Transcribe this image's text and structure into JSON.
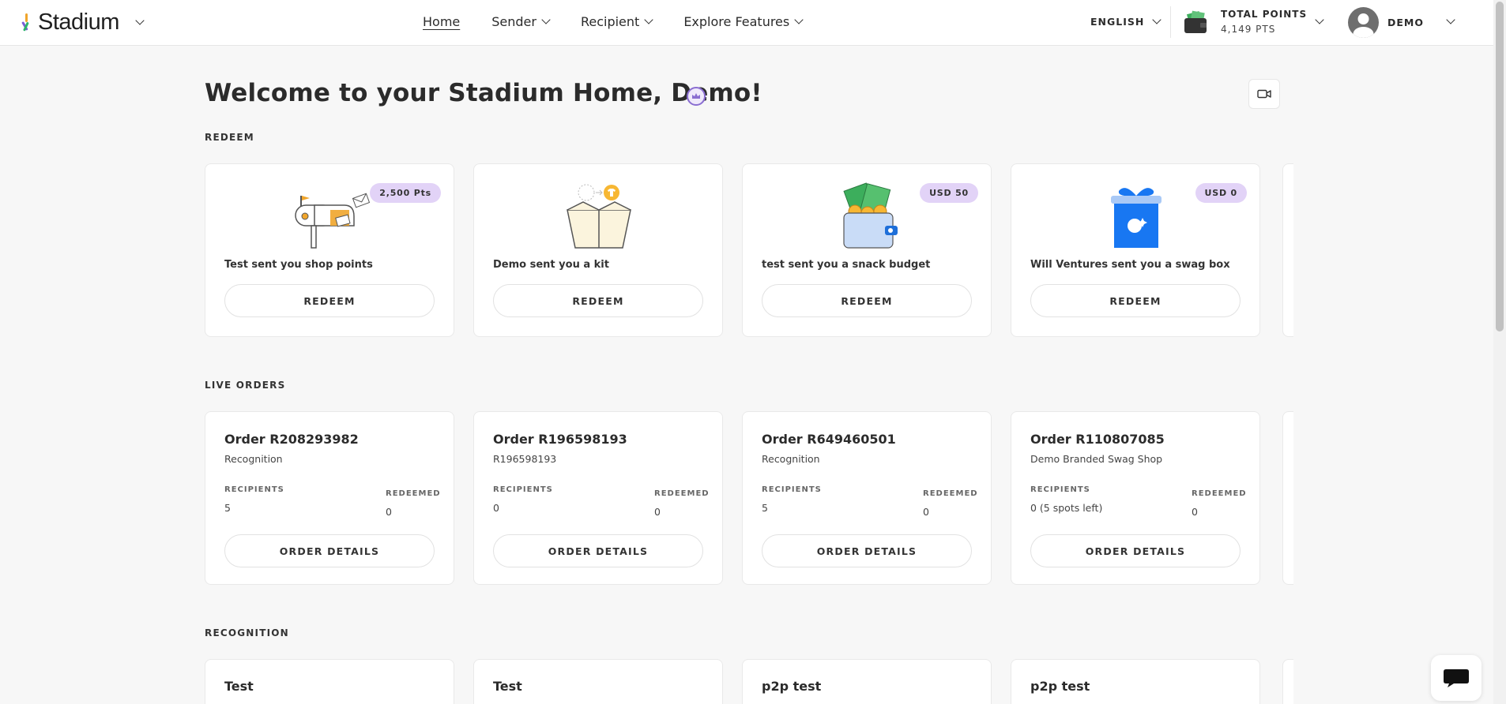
{
  "header": {
    "logo_text": "Stadium",
    "nav": [
      {
        "label": "Home",
        "active": true
      },
      {
        "label": "Sender"
      },
      {
        "label": "Recipient"
      },
      {
        "label": "Explore Features"
      }
    ],
    "language": "ENGLISH",
    "points_label": "TOTAL POINTS",
    "points_value": "4,149 PTS",
    "user_name": "DEMO"
  },
  "welcome": "Welcome to your Stadium Home, Demo!",
  "sections": {
    "redeem": "REDEEM",
    "live_orders": "LIVE ORDERS",
    "recognition": "RECOGNITION"
  },
  "redeem_cards": [
    {
      "text": "Test sent you shop points",
      "badge": "2,500 Pts",
      "button": "REDEEM",
      "icon": "mailbox-icon"
    },
    {
      "text": "Demo sent you a kit",
      "badge": "",
      "button": "REDEEM",
      "icon": "box-icon"
    },
    {
      "text": "test sent you a snack budget",
      "badge": "USD 50",
      "button": "REDEEM",
      "icon": "wallet-money-icon"
    },
    {
      "text": "Will Ventures sent you a swag box",
      "badge": "USD 0",
      "button": "REDEEM",
      "icon": "gift-box-icon"
    }
  ],
  "orders": [
    {
      "title": "Order R208293982",
      "sub": "Recognition",
      "recipients_label": "RECIPIENTS",
      "recipients": "5",
      "redeemed_label": "REDEEMED",
      "redeemed": "0",
      "button": "ORDER DETAILS"
    },
    {
      "title": "Order R196598193",
      "sub": "R196598193",
      "recipients_label": "RECIPIENTS",
      "recipients": "0",
      "redeemed_label": "REDEEMED",
      "redeemed": "0",
      "button": "ORDER DETAILS"
    },
    {
      "title": "Order R649460501",
      "sub": "Recognition",
      "recipients_label": "RECIPIENTS",
      "recipients": "5",
      "redeemed_label": "REDEEMED",
      "redeemed": "0",
      "button": "ORDER DETAILS"
    },
    {
      "title": "Order R110807085",
      "sub": "Demo Branded Swag Shop",
      "recipients_label": "RECIPIENTS",
      "recipients": "0 (5 spots left)",
      "redeemed_label": "REDEEMED",
      "redeemed": "0",
      "button": "ORDER DETAILS"
    }
  ],
  "recognition": [
    {
      "title": "Test"
    },
    {
      "title": "Test"
    },
    {
      "title": "p2p test"
    },
    {
      "title": "p2p test"
    }
  ],
  "colors": {
    "accent_purple": "#8a6dd1",
    "badge_bg": "#e2d3f7",
    "gift_blue": "#1877f2"
  }
}
